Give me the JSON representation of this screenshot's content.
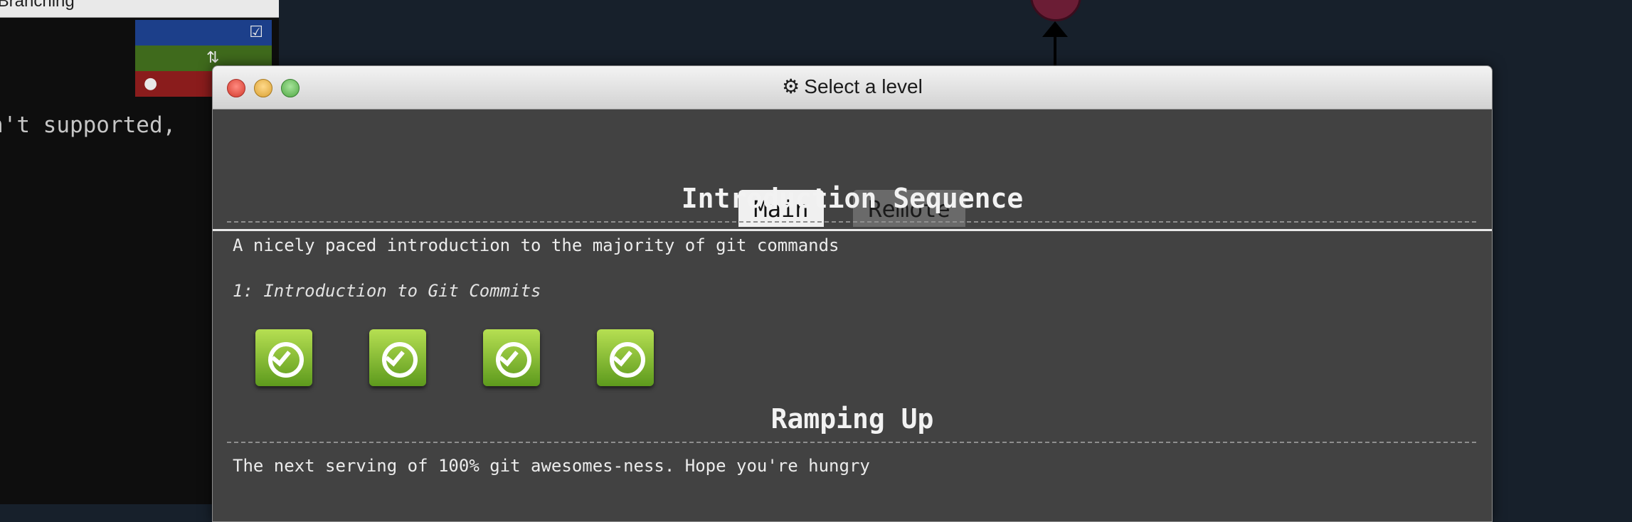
{
  "background": {
    "left_panel": {
      "header_text": "it Branching",
      "code_line": "n't supported,",
      "status_bars": [
        "blue",
        "green",
        "red"
      ]
    }
  },
  "modal": {
    "title": "Select a level",
    "title_icon": "gear-icon",
    "tabs": [
      {
        "label": "Main",
        "active": true
      },
      {
        "label": "Remote",
        "active": false
      }
    ],
    "sections": [
      {
        "title": "Introduction Sequence",
        "description": "A nicely paced introduction to the majority of git commands",
        "level_name": "1: Introduction to Git Commits",
        "levels_completed": 4
      },
      {
        "title": "Ramping Up",
        "description": "The next serving of 100% git awesomes-ness. Hope you're hungry"
      }
    ]
  },
  "colors": {
    "modal_bg": "#424242",
    "level_complete": "#8bc034",
    "tab_active": "#f0f0f0",
    "tab_inactive": "#6a6a6a"
  }
}
